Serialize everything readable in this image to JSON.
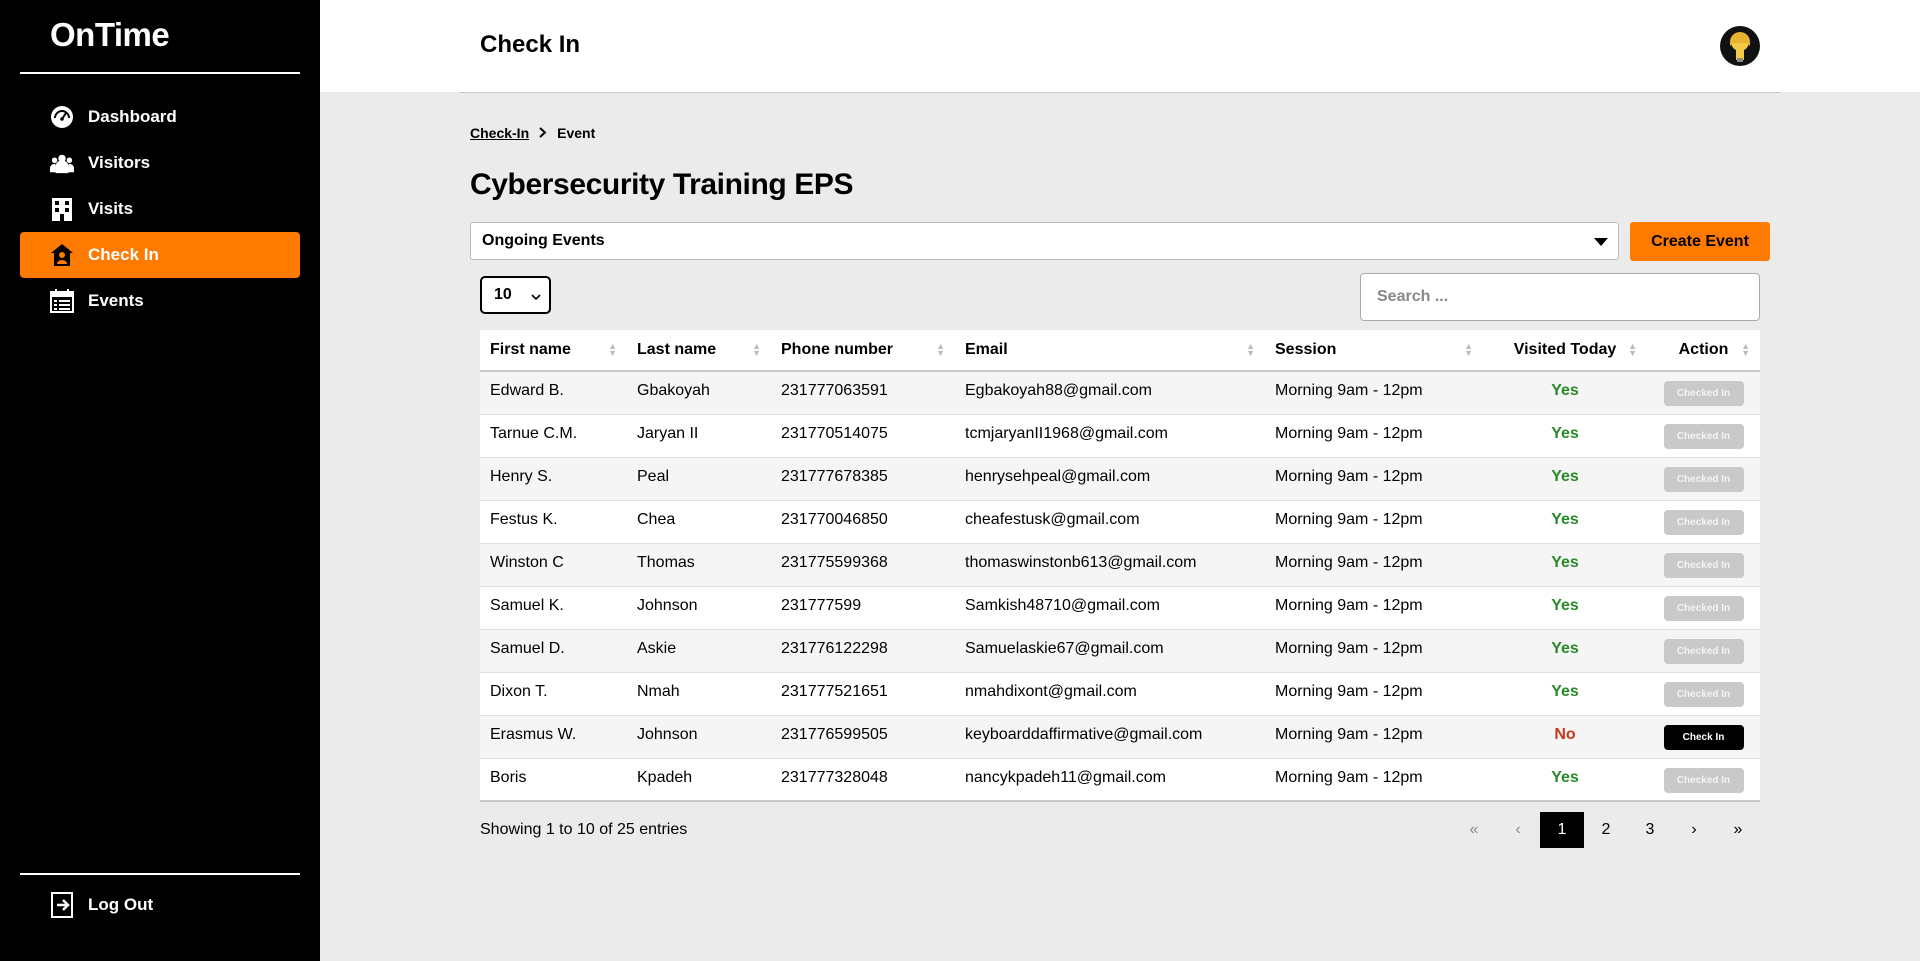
{
  "app": {
    "brand": "OnTime"
  },
  "sidebar": {
    "items": [
      {
        "label": "Dashboard",
        "icon": "dashboard-gauge-icon"
      },
      {
        "label": "Visitors",
        "icon": "users-icon"
      },
      {
        "label": "Visits",
        "icon": "building-icon"
      },
      {
        "label": "Check In",
        "icon": "checkin-icon"
      },
      {
        "label": "Events",
        "icon": "calendar-icon"
      }
    ],
    "active_index": 3,
    "logout_label": "Log Out"
  },
  "header": {
    "title": "Check In"
  },
  "breadcrumb": {
    "parent": "Check-In",
    "current": "Event"
  },
  "event": {
    "title": "Cybersecurity Training EPS"
  },
  "filter": {
    "selected": "Ongoing Events"
  },
  "create_button": "Create Event",
  "page_size": "10",
  "search": {
    "placeholder": "Search ..."
  },
  "table": {
    "columns": [
      "First name",
      "Last name",
      "Phone number",
      "Email",
      "Session",
      "Visited Today",
      "Action"
    ],
    "rows": [
      {
        "first": "Edward B.",
        "last": "Gbakoyah",
        "phone": "231777063591",
        "email": "Egbakoyah88@gmail.com",
        "session": "Morning 9am - 12pm",
        "visited": "Yes",
        "action": "Checked In"
      },
      {
        "first": "Tarnue C.M.",
        "last": "Jaryan II",
        "phone": "231770514075",
        "email": "tcmjaryanII1968@gmail.com",
        "session": "Morning 9am - 12pm",
        "visited": "Yes",
        "action": "Checked In"
      },
      {
        "first": "Henry S.",
        "last": "Peal",
        "phone": "231777678385",
        "email": "henrysehpeal@gmail.com",
        "session": "Morning 9am - 12pm",
        "visited": "Yes",
        "action": "Checked In"
      },
      {
        "first": "Festus K.",
        "last": "Chea",
        "phone": "231770046850",
        "email": "cheafestusk@gmail.com",
        "session": "Morning 9am - 12pm",
        "visited": "Yes",
        "action": "Checked In"
      },
      {
        "first": "Winston C",
        "last": "Thomas",
        "phone": "231775599368",
        "email": "thomaswinstonb613@gmail.com",
        "session": "Morning 9am - 12pm",
        "visited": "Yes",
        "action": "Checked In"
      },
      {
        "first": "Samuel K.",
        "last": "Johnson",
        "phone": "231777599",
        "email": "Samkish48710@gmail.com",
        "session": "Morning 9am - 12pm",
        "visited": "Yes",
        "action": "Checked In"
      },
      {
        "first": "Samuel D.",
        "last": "Askie",
        "phone": "231776122298",
        "email": "Samuelaskie67@gmail.com",
        "session": "Morning 9am - 12pm",
        "visited": "Yes",
        "action": "Checked In"
      },
      {
        "first": "Dixon T.",
        "last": "Nmah",
        "phone": "231777521651",
        "email": "nmahdixont@gmail.com",
        "session": "Morning 9am - 12pm",
        "visited": "Yes",
        "action": "Checked In"
      },
      {
        "first": "Erasmus W.",
        "last": "Johnson",
        "phone": "231776599505",
        "email": "keyboarddaffirmative@gmail.com",
        "session": "Morning 9am - 12pm",
        "visited": "No",
        "action": "Check In"
      },
      {
        "first": "Boris",
        "last": "Kpadeh",
        "phone": "231777328048",
        "email": "nancykpadeh11@gmail.com",
        "session": "Morning 9am - 12pm",
        "visited": "Yes",
        "action": "Checked In"
      }
    ]
  },
  "footer": {
    "entries_text": "Showing 1 to 10 of 25 entries",
    "pagination": {
      "first": "«",
      "prev": "‹",
      "pages": [
        "1",
        "2",
        "3"
      ],
      "current": "1",
      "next": "›",
      "last": "»"
    }
  },
  "colors": {
    "accent": "#ff7a00",
    "sidebar_bg": "#000000",
    "yes": "#2a8a2a",
    "no": "#c8381b"
  }
}
